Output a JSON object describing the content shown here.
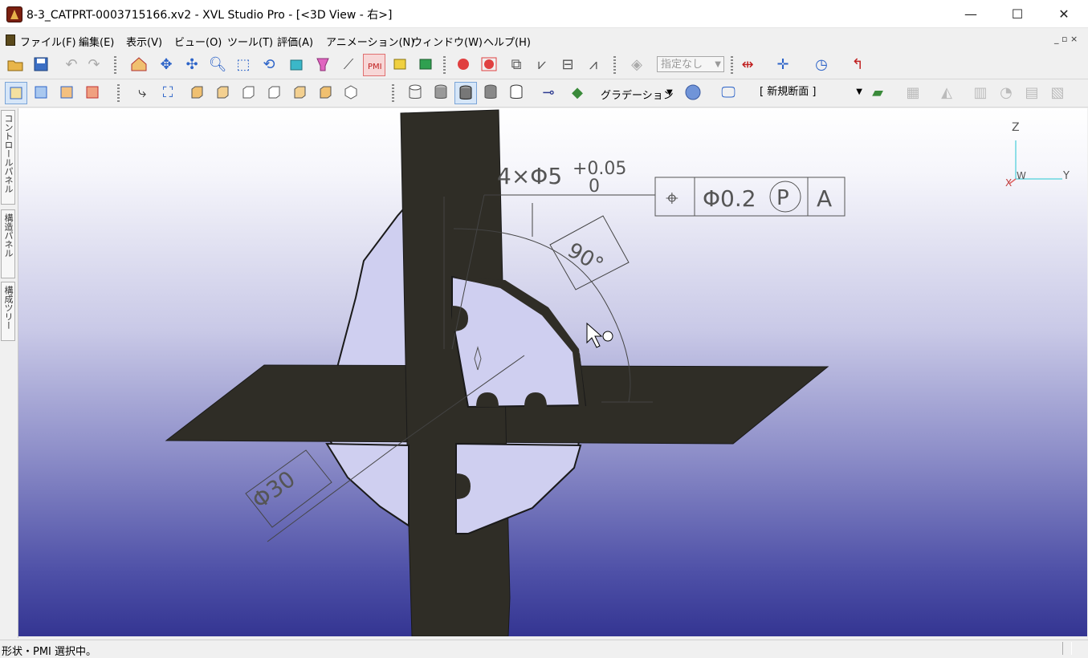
{
  "window": {
    "title": "8-3_CATPRT-0003715166.xv2 - XVL Studio Pro - [<3D View - 右>]",
    "minimize": "—",
    "maximize": "☐",
    "close": "✕"
  },
  "menu": {
    "items": [
      "ファイル(F)",
      "編集(E)",
      "表示(V)",
      "ビュー(O)",
      "ツール(T)",
      "評価(A)",
      "アニメーション(N)",
      "ウィンドウ(W)",
      "ヘルプ(H)"
    ],
    "mdi_controls": "_ ▫ ×"
  },
  "toolbar1": {
    "selection_combo": "指定なし"
  },
  "toolbar2": {
    "shading_label": "グラデーション",
    "section_combo": "[ 新規断面 ]"
  },
  "side_tabs": [
    "コントロールパネル",
    "構造パネル",
    "構成ツリー"
  ],
  "viewport": {
    "axis_labels": {
      "z": "Z",
      "x": "X",
      "w": "W",
      "y": "Y"
    },
    "pmi": {
      "hole_callout": "4×Φ5",
      "tol_upper": "+0.05",
      "tol_lower": "0",
      "fcf_symbol": "⌖",
      "fcf_tolerance": "Φ0.2",
      "fcf_modifier": "P",
      "fcf_datum": "A",
      "angle": "90°",
      "diameter": "Φ30"
    }
  },
  "status": {
    "text": "形状・PMI 選択中。"
  },
  "colors": {
    "part_dark": "#2f2d26",
    "disk": "#cfcff0",
    "bg_top": "#ffffff",
    "bg_bottom": "#343592",
    "pmi_line": "#444444"
  }
}
